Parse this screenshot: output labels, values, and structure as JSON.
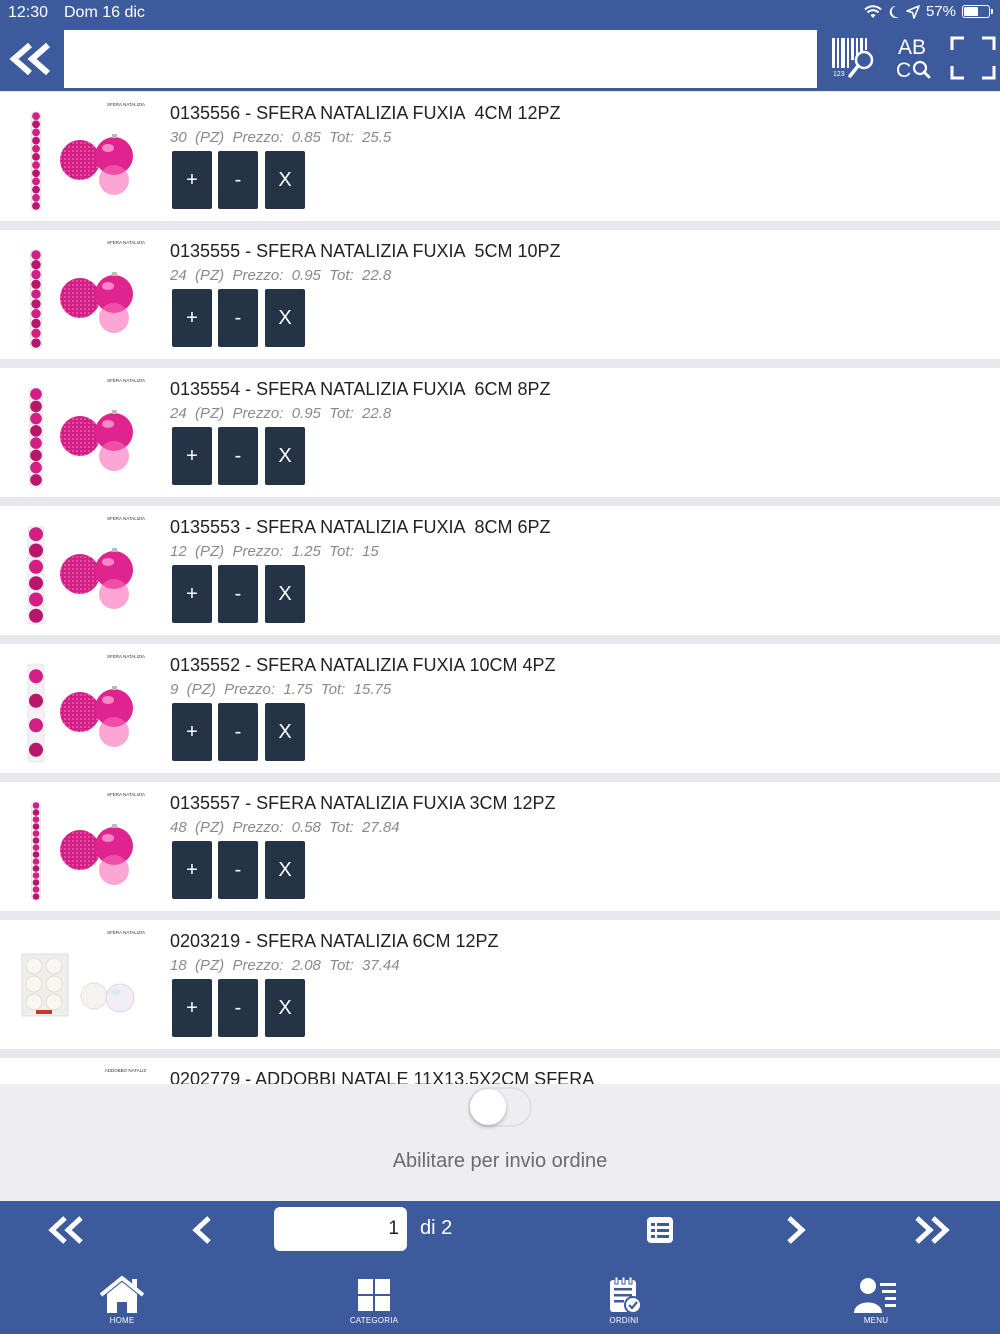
{
  "status_bar": {
    "time": "12:30",
    "date": "Dom 16 dic",
    "battery": "57%",
    "battery_level": 0.57
  },
  "header": {
    "search_value": "",
    "icons": [
      "double-chevron-left-icon",
      "barcode-search-icon",
      "text-search-icon",
      "scan-frame-icon"
    ]
  },
  "buttons": {
    "plus": "+",
    "minus": "-",
    "remove": "X"
  },
  "products": [
    {
      "name": "0135556 - SFERA NATALIZIA FUXIA  4CM 12PZ",
      "detail": "30  (PZ)  Prezzo:  0.85  Tot:  25.5",
      "thumb_caption": "SFERA NATALIZIA FUXIA 4CM 12PZ",
      "tube_count": 12,
      "thumb_color": "#d21f85"
    },
    {
      "name": "0135555 - SFERA NATALIZIA FUXIA  5CM 10PZ",
      "detail": "24  (PZ)  Prezzo:  0.95  Tot:  22.8",
      "thumb_caption": "SFERA NATALIZIA FUXIA 5CM 10PZ",
      "tube_count": 10,
      "thumb_color": "#d21f85"
    },
    {
      "name": "0135554 - SFERA NATALIZIA FUXIA  6CM 8PZ",
      "detail": "24  (PZ)  Prezzo:  0.95  Tot:  22.8",
      "thumb_caption": "SFERA NATALIZIA FUXIA 6CM 8PZ",
      "tube_count": 8,
      "thumb_color": "#d21f85"
    },
    {
      "name": "0135553 - SFERA NATALIZIA FUXIA  8CM 6PZ",
      "detail": "12  (PZ)  Prezzo:  1.25  Tot:  15",
      "thumb_caption": "SFERA NATALIZIA FUXIA 8CM 6PZ",
      "tube_count": 6,
      "thumb_color": "#d21f85"
    },
    {
      "name": "0135552 - SFERA NATALIZIA FUXIA 10CM 4PZ",
      "detail": "9  (PZ)  Prezzo:  1.75  Tot:  15.75",
      "thumb_caption": "SFERA NATALIZIA FUXIA 10CM 4PZ",
      "tube_count": 4,
      "thumb_color": "#d21f85"
    },
    {
      "name": "0135557 - SFERA NATALIZIA FUXIA 3CM 12PZ",
      "detail": "48  (PZ)  Prezzo:  0.58  Tot:  27.84",
      "thumb_caption": "SFERA NATALIZIA FUXIA 3CM 12PZ",
      "tube_count": 14,
      "thumb_color": "#d21f85"
    },
    {
      "name": "0203219 - SFERA NATALIZIA 6CM 12PZ",
      "detail": "18  (PZ)  Prezzo:  2.08  Tot:  37.44",
      "thumb_caption": "SFERA NATALIZIA 6CM 12PZ",
      "tube_count": 0,
      "thumb_color": "#e8e4dc"
    },
    {
      "name": "0202779 - ADDOBBI NATALE 11X13.5X2CM SFERA",
      "detail": "",
      "thumb_caption": "ADDOBBO NATALIZIO 11X13.5X2CM",
      "tube_count": 0,
      "thumb_color": "#ffffff"
    }
  ],
  "order_toggle": {
    "label": "Abilitare per invio ordine",
    "enabled": false
  },
  "pagination": {
    "current_page": "1",
    "total_label": "di 2"
  },
  "tabs": [
    {
      "label": "HOME",
      "icon": "home-icon"
    },
    {
      "label": "CATEGORIA",
      "icon": "category-grid-icon"
    },
    {
      "label": "ORDINI",
      "icon": "orders-clipboard-icon"
    },
    {
      "label": "MENU",
      "icon": "user-menu-icon"
    }
  ],
  "colors": {
    "bar_blue": "#3d5a9c",
    "button_dark": "#253346",
    "list_bg": "#e7e8ed"
  }
}
